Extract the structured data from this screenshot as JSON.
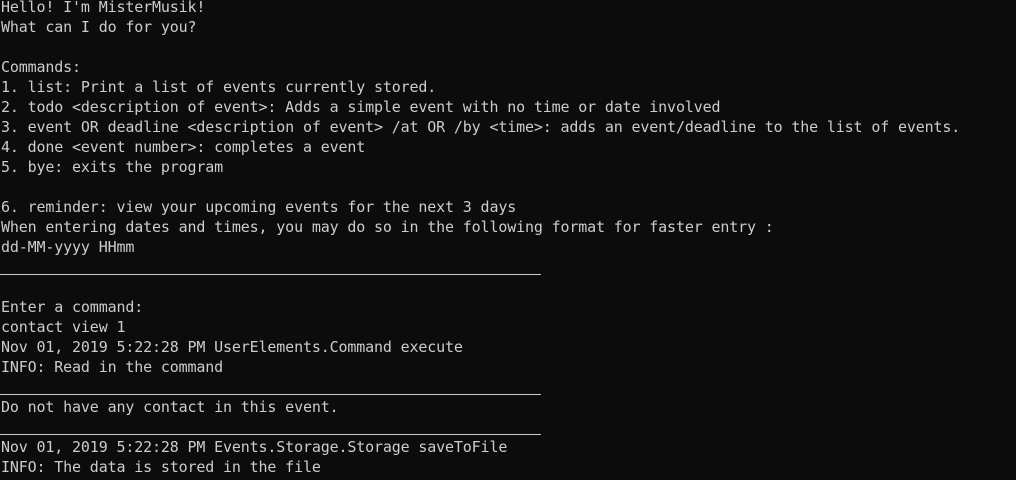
{
  "colors": {
    "background": "#0c0c0c",
    "text": "#cccccc"
  },
  "console": {
    "greeting": "Hello! I'm MisterMusik!",
    "prompt_question": "What can I do for you?",
    "commands_heading": "Commands:",
    "commands": [
      "1. list: Print a list of events currently stored.",
      "2. todo <description of event>: Adds a simple event with no time or date involved",
      "3. event OR deadline <description of event> /at OR /by <time>: adds an event/deadline to the list of events.",
      "4. done <event number>: completes a event",
      "5. bye: exits the program",
      "6. reminder: view your upcoming events for the next 3 days"
    ],
    "date_hint": "When entering dates and times, you may do so in the following format for faster entry :",
    "date_format": "dd-MM-yyyy HHmm",
    "enter_command": "Enter a command:",
    "user_input": "contact view 1",
    "log1_header": "Nov 01, 2019 5:22:28 PM UserElements.Command execute",
    "log1_info": "INFO: Read in the command",
    "response": "Do not have any contact in this event.",
    "log2_header": "Nov 01, 2019 5:22:28 PM Events.Storage.Storage saveToFile",
    "log2_info": "INFO: The data is stored in the file"
  }
}
